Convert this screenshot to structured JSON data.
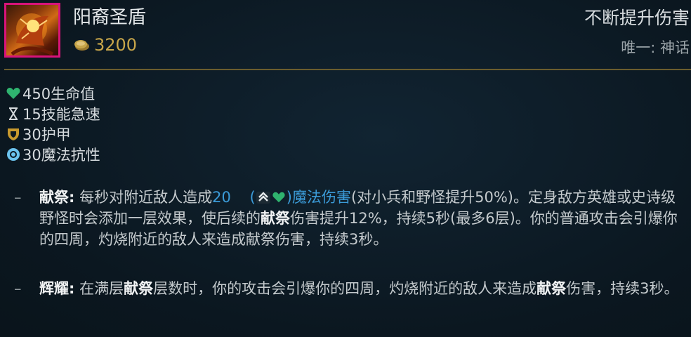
{
  "item": {
    "name": "阳裔圣盾",
    "cost": "3200",
    "tagline": "不断提升伤害",
    "rarity": "唯一: 神话"
  },
  "icons": {
    "item": "sunfire-aegis-icon",
    "gold": "gold-coin-icon",
    "health": "heart-icon",
    "haste": "hourglass-icon",
    "armor": "shield-icon",
    "mr": "magic-resist-icon",
    "ap_scaling": "chevron-up-icon",
    "hp_scaling": "heart-icon"
  },
  "colors": {
    "background": "#0c1821",
    "icon_border": "#d8147a",
    "gold": "#c8a64a",
    "divider": "#6b5d2e",
    "health": "#2fb36f",
    "magic_damage": "#3b9bd8"
  },
  "stats": [
    {
      "icon": "heart-icon",
      "text": "450生命值"
    },
    {
      "icon": "hourglass-icon",
      "text": "15技能急速"
    },
    {
      "icon": "shield-icon",
      "text": "30护甲"
    },
    {
      "icon": "magic-resist-icon",
      "text": "30魔法抗性"
    }
  ],
  "passives": {
    "immolate": {
      "dash": "–",
      "name": "献祭:",
      "p1": "每秒对附近敌人造成",
      "value": "20",
      "paren_open": "(",
      "paren_close": ")",
      "dmg_type": "魔法伤害",
      "p2": "(对小兵和野怪提升50%)。定身敌方英雄或史诗级野怪时会添加一层效果，使后续的",
      "kw1": "献祭",
      "p3": "伤害提升12%，持续5秒(最多6层)。你的普通攻击会引爆你的四周，灼烧附近的敌人来造成献祭伤害，持续3秒。"
    },
    "radiance": {
      "dash": "–",
      "name": "辉耀:",
      "p1": "在满层",
      "kw1": "献祭",
      "p2": "层数时，你的攻击会引爆你的四周，灼烧附近的敌人来造成",
      "kw2": "献祭",
      "p3": "伤害，持续3秒。"
    }
  }
}
